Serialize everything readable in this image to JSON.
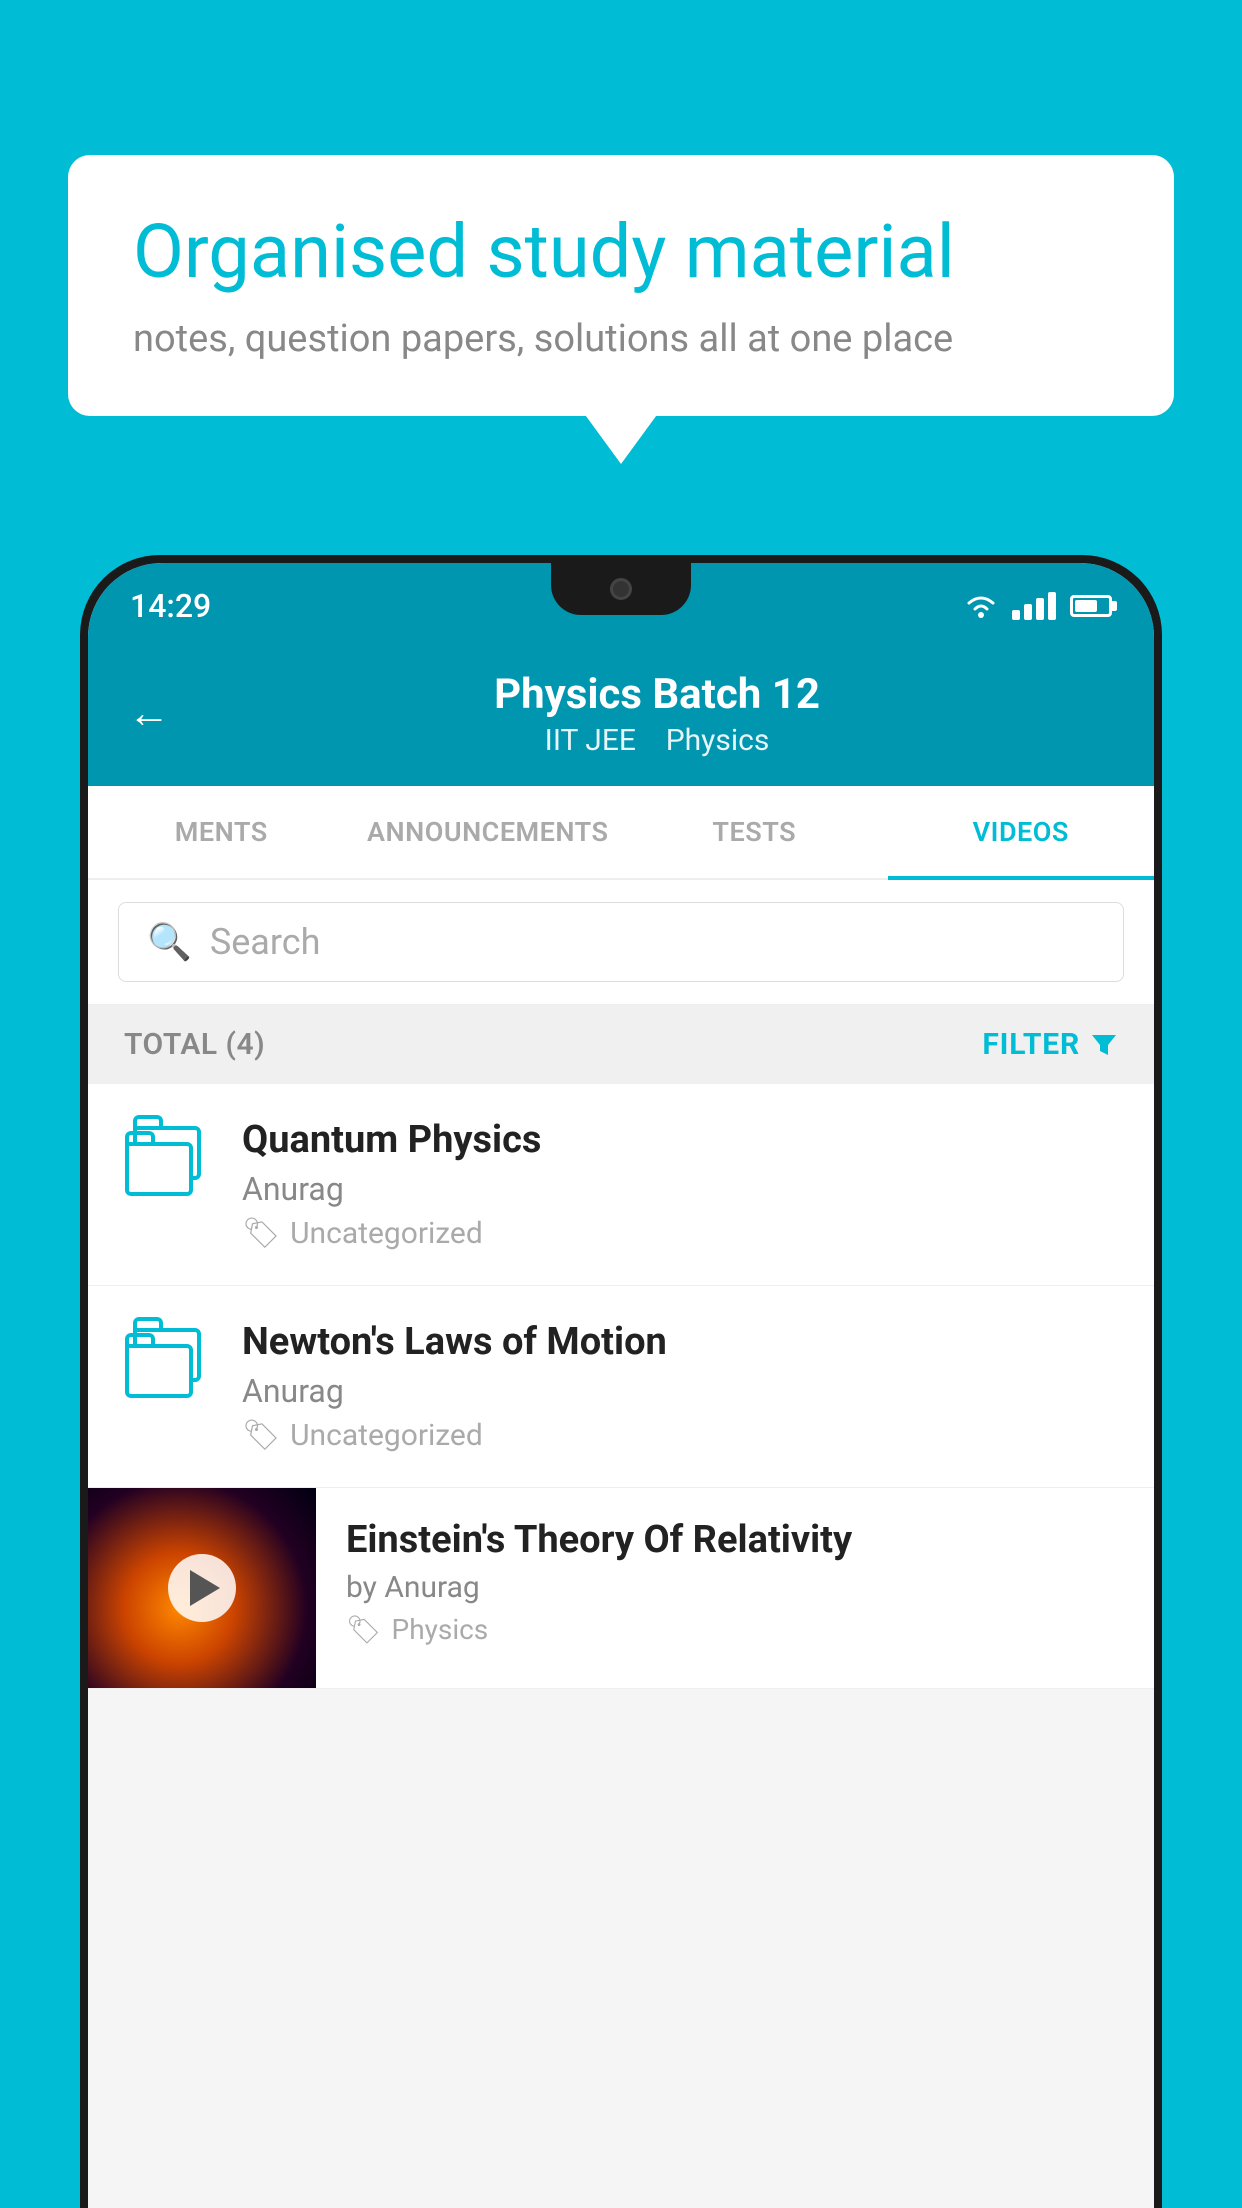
{
  "background_color": "#00bcd4",
  "speech_bubble": {
    "title": "Organised study material",
    "subtitle": "notes, question papers, solutions all at one place"
  },
  "status_bar": {
    "time": "14:29",
    "wifi": "▼",
    "battery_percent": 70
  },
  "app_header": {
    "back_label": "←",
    "title": "Physics Batch 12",
    "subtitle_tag1": "IIT JEE",
    "subtitle_tag2": "Physics"
  },
  "tabs": [
    {
      "label": "MENTS",
      "active": false
    },
    {
      "label": "ANNOUNCEMENTS",
      "active": false
    },
    {
      "label": "TESTS",
      "active": false
    },
    {
      "label": "VIDEOS",
      "active": true
    }
  ],
  "search": {
    "placeholder": "Search"
  },
  "filter_row": {
    "total_label": "TOTAL (4)",
    "filter_label": "FILTER"
  },
  "video_items": [
    {
      "title": "Quantum Physics",
      "author": "Anurag",
      "tag": "Uncategorized",
      "type": "folder"
    },
    {
      "title": "Newton's Laws of Motion",
      "author": "Anurag",
      "tag": "Uncategorized",
      "type": "folder"
    },
    {
      "title": "Einstein's Theory Of Relativity",
      "author": "by Anurag",
      "tag": "Physics",
      "type": "thumbnail"
    }
  ]
}
